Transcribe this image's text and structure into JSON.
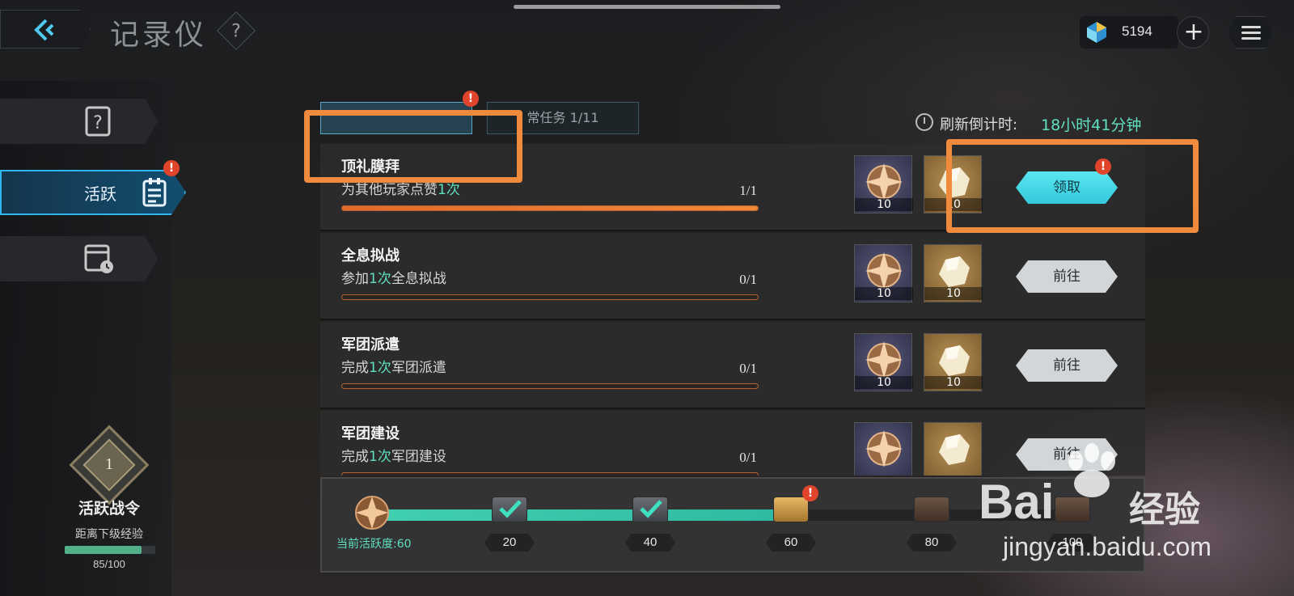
{
  "header": {
    "title": "记录仪",
    "help": "?",
    "currency_value": "5194",
    "plus_label": "+"
  },
  "sidebar": {
    "items": [
      {
        "label": "",
        "icon": "question-book-icon"
      },
      {
        "label": "活跃",
        "icon": "document-icon",
        "active": true,
        "badge": "!"
      },
      {
        "label": "",
        "icon": "calendar-icon"
      }
    ],
    "rank": {
      "level": "1",
      "title": "活跃战令",
      "subtitle": "距离下级经验",
      "progress_text": "85/100",
      "progress_fraction": 0.85
    }
  },
  "tabs": [
    {
      "label": "",
      "active": true,
      "badge": "!"
    },
    {
      "label": "常任务 1/11",
      "active": false
    }
  ],
  "timer": {
    "label": "刷新倒计时:",
    "value": "18小时41分钟"
  },
  "tasks": [
    {
      "name": "顶礼膜拜",
      "desc_pre": "为其他玩家点赞",
      "desc_hl": "1次",
      "desc_post": "",
      "count": "1/1",
      "progress": 1.0,
      "reward1_qty": "10",
      "reward2_qty": "10",
      "button": "领取",
      "claimable": true
    },
    {
      "name": "全息拟战",
      "desc_pre": "参加",
      "desc_hl": "1次",
      "desc_post": "全息拟战",
      "count": "0/1",
      "progress": 0.0,
      "reward1_qty": "10",
      "reward2_qty": "10",
      "button": "前往",
      "claimable": false
    },
    {
      "name": "军团派遣",
      "desc_pre": "完成",
      "desc_hl": "1次",
      "desc_post": "军团派遣",
      "count": "0/1",
      "progress": 0.0,
      "reward1_qty": "10",
      "reward2_qty": "10",
      "button": "前往",
      "claimable": false
    },
    {
      "name": "军团建设",
      "desc_pre": "完成",
      "desc_hl": "1次",
      "desc_post": "军团建设",
      "count": "0/1",
      "progress": 0.0,
      "reward1_qty": "",
      "reward2_qty": "",
      "button": "前往",
      "claimable": false
    }
  ],
  "activity": {
    "current_label": "当前活跃度:",
    "current_value": "60",
    "milestones": [
      {
        "value": "20",
        "state": "claimed"
      },
      {
        "value": "40",
        "state": "claimed"
      },
      {
        "value": "60",
        "state": "claimable",
        "badge": "!"
      },
      {
        "value": "80",
        "state": "locked"
      },
      {
        "value": "100",
        "state": "locked"
      }
    ],
    "progress_fraction": 0.6
  },
  "watermark": {
    "brand": "Bai",
    "brand_cn": "经验",
    "url": "jingyan.baidu.com"
  },
  "colors": {
    "accent_teal": "#5fe0c0",
    "claim_button": "#4fdbe8",
    "badge_red": "#e0452c",
    "highlight_orange": "#f08a3c"
  }
}
